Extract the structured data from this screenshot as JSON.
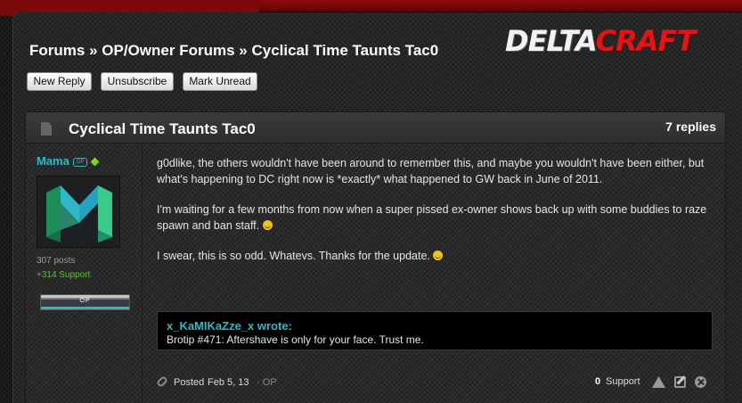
{
  "breadcrumb": {
    "forums": "Forums",
    "sep1": "»",
    "section": "OP/Owner Forums",
    "sep2": "»",
    "thread": "Cyclical Time Taunts Tac0"
  },
  "logo": {
    "part1": "DELTA",
    "part2": "CRAFT"
  },
  "buttons": {
    "new_reply": "New Reply",
    "unsubscribe": "Unsubscribe",
    "mark_unread": "Mark Unread"
  },
  "thread": {
    "title": "Cyclical Time Taunts Tac0",
    "replies": "7 replies"
  },
  "post": {
    "author": {
      "name": "Mama",
      "badge": "OP",
      "post_count": "307 posts",
      "support": "+314 Support",
      "rank_label": "OP"
    },
    "paragraphs": [
      "g0dlike, the others wouldn't have been around to remember this, and maybe you wouldn't have been either, but what's happening to DC right now is *exactly* what happened to GW back in June of 2011.",
      "I'm waiting for a few months from now when a super pissed ex-owner shows back up with some buddies to raze spawn and ban staff.",
      "I swear, this is so odd. Whatevs. Thanks for the update."
    ],
    "quote": {
      "author": "x_KaMIKaZze_x wrote:",
      "text": "Brotip #471: Aftershave is only for your face. Trust me."
    },
    "footer": {
      "posted_label": "Posted",
      "date": "Feb 5, 13",
      "op_tag": "· OP",
      "support_value": "0",
      "support_label": "Support"
    }
  },
  "colors": {
    "accent": "#2fb8c9",
    "brand_red": "#e01515",
    "support_green": "#5cc22e"
  },
  "icons": [
    "doc-icon",
    "online-icon",
    "link-icon",
    "report-icon",
    "edit-icon",
    "delete-icon",
    "smiley-icon"
  ]
}
